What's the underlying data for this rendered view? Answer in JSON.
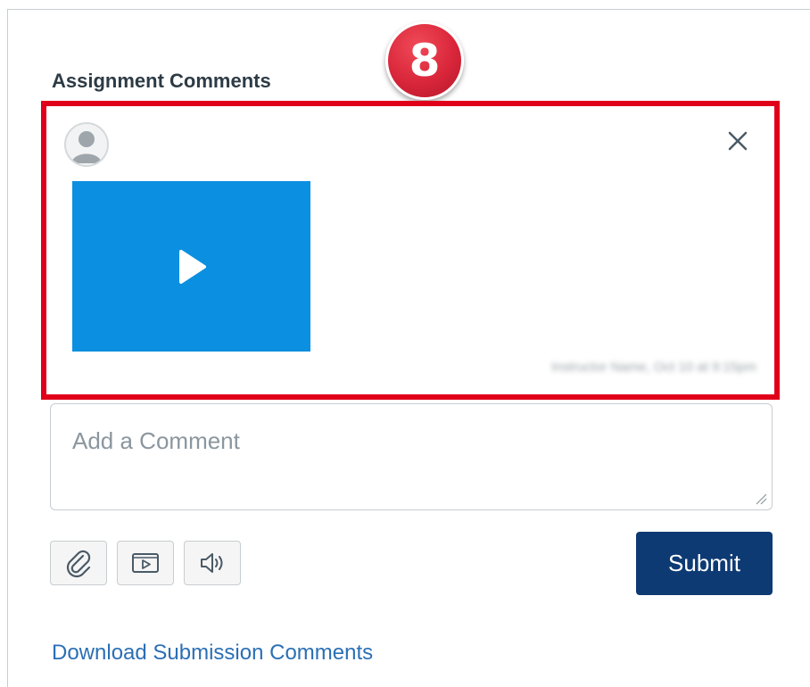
{
  "step_badge": "8",
  "section_title": "Assignment Comments",
  "comment": {
    "media_type": "video",
    "meta_text": "Instructor Name, Oct 10 at 9:15pm",
    "delete_icon": "close-icon",
    "play_icon": "play-icon",
    "media_color": "#0B8FE0"
  },
  "comment_input": {
    "placeholder": "Add a Comment",
    "value": ""
  },
  "toolbar": {
    "attach_icon": "paperclip-icon",
    "media_icon": "media-comment-icon",
    "audio_icon": "speaker-icon"
  },
  "submit_label": "Submit",
  "download_link": "Download Submission Comments",
  "colors": {
    "highlight": "#E0001A",
    "badge": "#D9263A",
    "submit_bg": "#0E3A73",
    "link": "#2B6FB5"
  }
}
